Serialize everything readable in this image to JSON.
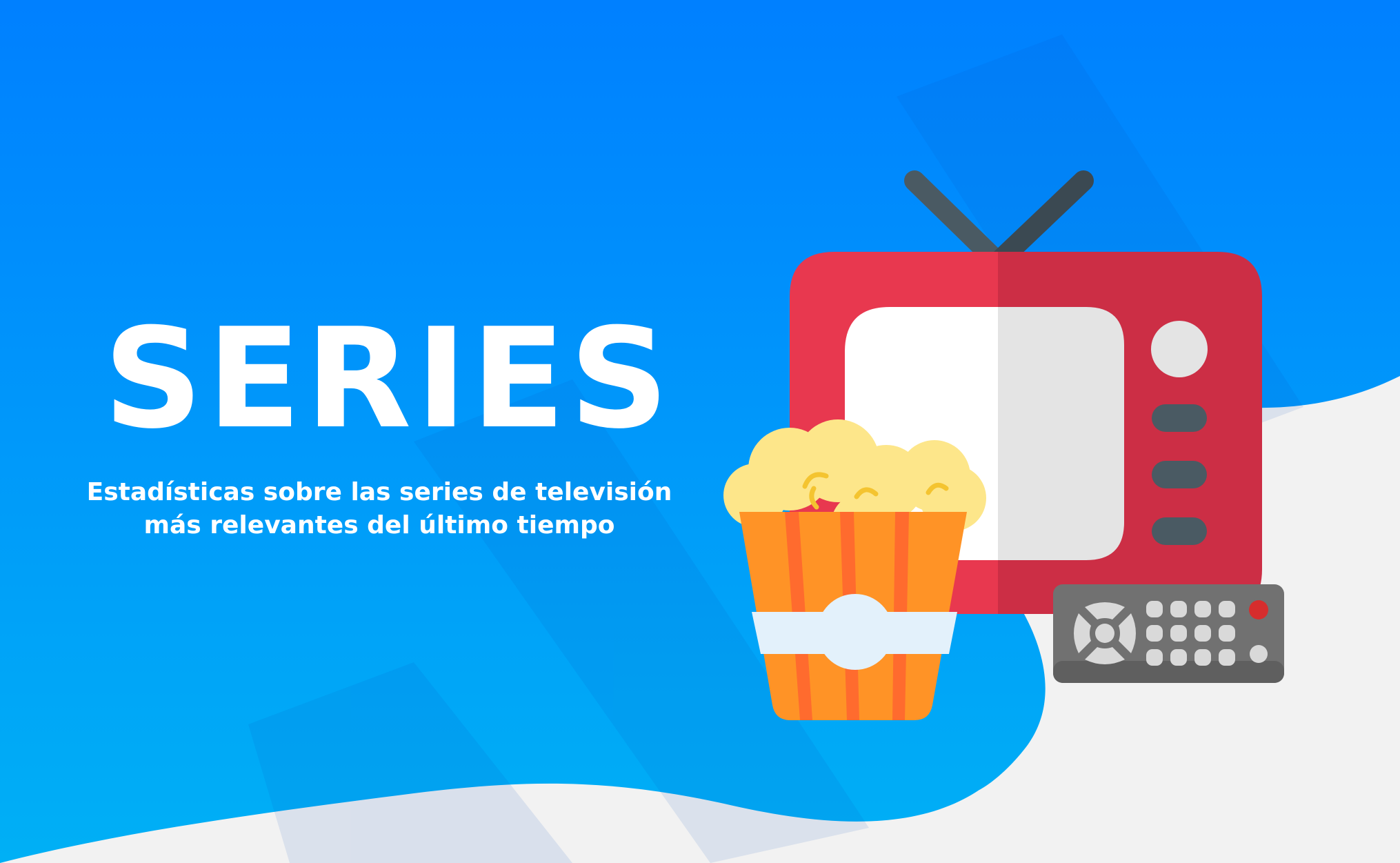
{
  "banner": {
    "title": "SERIES",
    "subtitle_line1": "Estadísticas sobre las series de televisión",
    "subtitle_line2": "más relevantes del último tiempo"
  },
  "illustration": {
    "icons": [
      "tv-icon",
      "popcorn-icon",
      "remote-control-icon"
    ]
  },
  "colors": {
    "background_blue_top": "#0080ff",
    "background_blue_bottom": "#00b0f5",
    "background_white": "#f2f2f2",
    "tv_red": "#e8384f",
    "tv_red_shade": "#cc2e45",
    "popcorn_orange": "#ff9326",
    "popcorn_yellow": "#fde68a",
    "remote_gray": "#717171"
  }
}
